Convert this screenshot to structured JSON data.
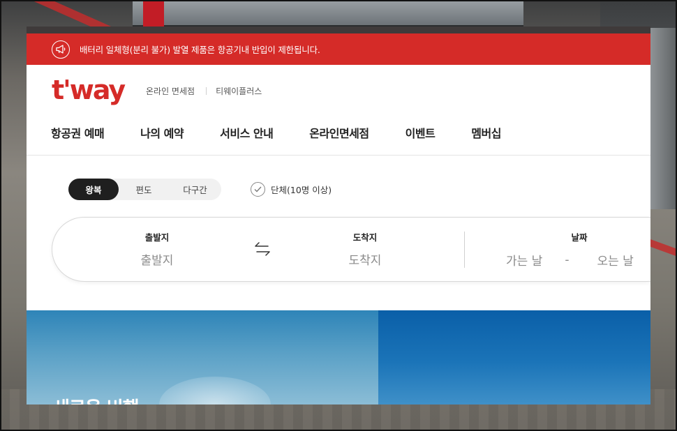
{
  "notice": {
    "text": "배터리 일체형(분리 불가) 발열 제품은 항공기내 반입이 제한됩니다."
  },
  "brand": {
    "logo_text": "t'way",
    "color": "#d52b28"
  },
  "util_links": [
    "온라인 면세점",
    "티웨이플러스"
  ],
  "gnb": [
    "항공권 예매",
    "나의 예약",
    "서비스 안내",
    "온라인면세점",
    "이벤트",
    "멤버십"
  ],
  "trip_types": [
    "왕복",
    "편도",
    "다구간"
  ],
  "active_trip_type": "왕복",
  "group_booking": {
    "label": "단체(10명 이상)",
    "checked": false
  },
  "search": {
    "departure": {
      "label": "출발지",
      "placeholder": "출발지"
    },
    "arrival": {
      "label": "도착지",
      "placeholder": "도착지"
    },
    "date": {
      "label": "날짜",
      "depart_placeholder": "가는 날",
      "separator": "-",
      "return_placeholder": "오는 날"
    }
  },
  "banner": {
    "title": "새로운 비행"
  },
  "icons": {
    "notice": "megaphone-icon",
    "check": "check-circle-icon",
    "swap": "swap-arrows-icon"
  }
}
